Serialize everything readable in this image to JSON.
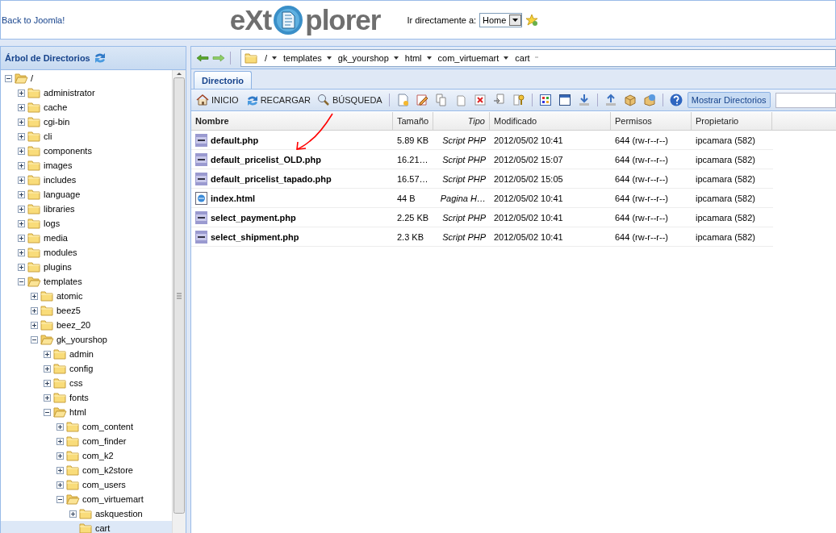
{
  "header": {
    "back_link": "Back to Joomla!",
    "logo": {
      "left": "eXt",
      "right": "plorer"
    },
    "jump": {
      "label": "Ir directamente a:",
      "value": "Home"
    }
  },
  "tree": {
    "title": "Árbol de Directorios",
    "items": [
      {
        "label": "/",
        "expanded": true,
        "selected": false,
        "children": [
          {
            "label": "administrator",
            "expanded": false,
            "selected": false
          },
          {
            "label": "cache",
            "expanded": false,
            "selected": false
          },
          {
            "label": "cgi-bin",
            "expanded": false,
            "selected": false
          },
          {
            "label": "cli",
            "expanded": false,
            "selected": false
          },
          {
            "label": "components",
            "expanded": false,
            "selected": false
          },
          {
            "label": "images",
            "expanded": false,
            "selected": false
          },
          {
            "label": "includes",
            "expanded": false,
            "selected": false
          },
          {
            "label": "language",
            "expanded": false,
            "selected": false
          },
          {
            "label": "libraries",
            "expanded": false,
            "selected": false
          },
          {
            "label": "logs",
            "expanded": false,
            "selected": false
          },
          {
            "label": "media",
            "expanded": false,
            "selected": false
          },
          {
            "label": "modules",
            "expanded": false,
            "selected": false
          },
          {
            "label": "plugins",
            "expanded": false,
            "selected": false
          },
          {
            "label": "templates",
            "expanded": true,
            "selected": false,
            "children": [
              {
                "label": "atomic",
                "expanded": false,
                "selected": false
              },
              {
                "label": "beez5",
                "expanded": false,
                "selected": false
              },
              {
                "label": "beez_20",
                "expanded": false,
                "selected": false
              },
              {
                "label": "gk_yourshop",
                "expanded": true,
                "selected": false,
                "children": [
                  {
                    "label": "admin",
                    "expanded": false,
                    "selected": false
                  },
                  {
                    "label": "config",
                    "expanded": false,
                    "selected": false
                  },
                  {
                    "label": "css",
                    "expanded": false,
                    "selected": false
                  },
                  {
                    "label": "fonts",
                    "expanded": false,
                    "selected": false
                  },
                  {
                    "label": "html",
                    "expanded": true,
                    "selected": false,
                    "children": [
                      {
                        "label": "com_content",
                        "expanded": false,
                        "selected": false
                      },
                      {
                        "label": "com_finder",
                        "expanded": false,
                        "selected": false
                      },
                      {
                        "label": "com_k2",
                        "expanded": false,
                        "selected": false
                      },
                      {
                        "label": "com_k2store",
                        "expanded": false,
                        "selected": false
                      },
                      {
                        "label": "com_users",
                        "expanded": false,
                        "selected": false
                      },
                      {
                        "label": "com_virtuemart",
                        "expanded": true,
                        "selected": false,
                        "children": [
                          {
                            "label": "askquestion",
                            "expanded": false,
                            "selected": false
                          },
                          {
                            "label": "cart",
                            "selected": true
                          }
                        ]
                      }
                    ]
                  }
                ]
              }
            ]
          }
        ]
      }
    ]
  },
  "path": [
    "/",
    "templates",
    "gk_yourshop",
    "html",
    "com_virtuemart",
    "cart"
  ],
  "tabs": [
    {
      "label": "Directorio",
      "selected": true
    }
  ],
  "toolbar": [
    {
      "kind": "button",
      "label": "INICIO"
    },
    {
      "kind": "button",
      "label": "RECARGAR"
    },
    {
      "kind": "button",
      "label": "BÚSQUEDA"
    },
    {
      "kind": "separator"
    },
    {
      "kind": "icon"
    },
    {
      "kind": "icon"
    },
    {
      "kind": "icon"
    },
    {
      "kind": "icon"
    },
    {
      "kind": "icon"
    },
    {
      "kind": "icon"
    },
    {
      "kind": "icon"
    },
    {
      "kind": "separator"
    },
    {
      "kind": "icon"
    },
    {
      "kind": "icon"
    },
    {
      "kind": "icon"
    },
    {
      "kind": "separator"
    },
    {
      "kind": "icon"
    },
    {
      "kind": "icon"
    },
    {
      "kind": "icon"
    },
    {
      "kind": "separator"
    },
    {
      "kind": "icon"
    },
    {
      "kind": "toggle",
      "label": "Mostrar Directorios",
      "on": true
    },
    {
      "kind": "field"
    }
  ],
  "table": {
    "columns": [
      "Nombre",
      "Tamaño",
      "Tipo",
      "Modificado",
      "Permisos",
      "Propietario"
    ],
    "rows": [
      {
        "kind": "php",
        "name": "default.php",
        "size": "5.89 KB",
        "type": "Script PHP",
        "modified": "2012/05/02 10:41",
        "permissions": "644 (rw-r--r--)",
        "owner": "ipcamara (582)"
      },
      {
        "kind": "php",
        "name": "default_pricelist_OLD.php",
        "size": "16.21…",
        "type": "Script PHP",
        "modified": "2012/05/02 15:07",
        "permissions": "644 (rw-r--r--)",
        "owner": "ipcamara (582)"
      },
      {
        "kind": "php",
        "name": "default_pricelist_tapado.php",
        "size": "16.57…",
        "type": "Script PHP",
        "modified": "2012/05/02 15:05",
        "permissions": "644 (rw-r--r--)",
        "owner": "ipcamara (582)"
      },
      {
        "kind": "html",
        "name": "index.html",
        "size": "44 B",
        "type": "Pagina H…",
        "modified": "2012/05/02 10:41",
        "permissions": "644 (rw-r--r--)",
        "owner": "ipcamara (582)"
      },
      {
        "kind": "php",
        "name": "select_payment.php",
        "size": "2.25 KB",
        "type": "Script PHP",
        "modified": "2012/05/02 10:41",
        "permissions": "644 (rw-r--r--)",
        "owner": "ipcamara (582)"
      },
      {
        "kind": "php",
        "name": "select_shipment.php",
        "size": "2.3 KB",
        "type": "Script PHP",
        "modified": "2012/05/02 10:41",
        "permissions": "644 (rw-r--r--)",
        "owner": "ipcamara (582)"
      }
    ]
  }
}
